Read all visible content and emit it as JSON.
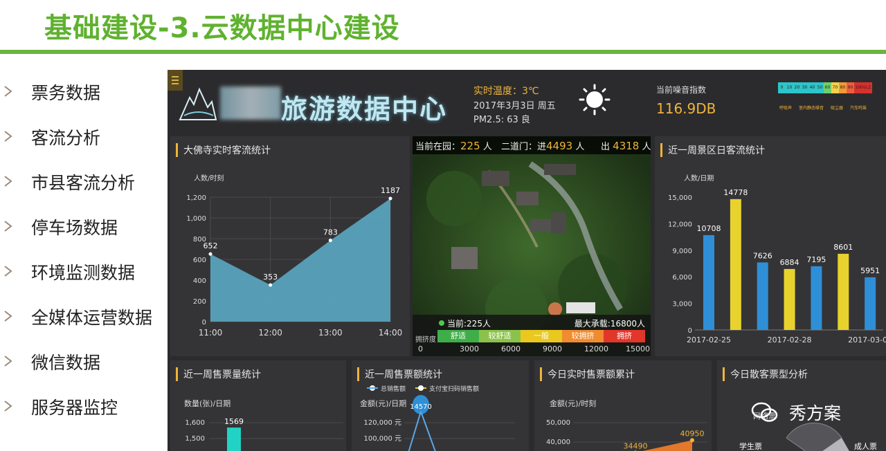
{
  "slide": {
    "title": "基础建设-3.云数据中心建设",
    "menu": [
      "票务数据",
      "客流分析",
      "市县客流分析",
      "停车场数据",
      "环境监测数据",
      "全媒体运营数据",
      "微信数据",
      "服务器监控"
    ]
  },
  "dashboard": {
    "title": "旅游数据中心",
    "temperature": "实时温度：3℃",
    "date": "2017年3月3日 周五",
    "pm25": "PM2.5: 63 良",
    "noise_label": "当前噪音指数",
    "noise_value": "116.9DB",
    "noise_scale": [
      "0",
      "10",
      "20",
      "30",
      "40",
      "50",
      "60",
      "70",
      "80",
      "90",
      "100以上"
    ],
    "noise_scale_colors": [
      "#2ec4c9",
      "#2ec4c9",
      "#2ec4c9",
      "#2ec4c9",
      "#2ec4c9",
      "#2ec4c9",
      "#6fcf6a",
      "#f2d34b",
      "#f29a38",
      "#ef5d3c",
      "#d9302c"
    ],
    "noise_tags": [
      "呼吸声",
      "室内静态噪音",
      "吸尘器",
      "汽车鸣笛"
    ]
  },
  "map": {
    "in_park_label": "当前在园：",
    "in_park_value": "225",
    "unit": "人",
    "gate_label": "二道门：进",
    "gate_value": "4493",
    "exit_label": "出",
    "exit_value": "4318",
    "current": "当前:225人",
    "max": "最大承载:16800人",
    "congestion_label": "拥挤度",
    "levels": [
      "舒适",
      "较舒适",
      "一般",
      "较拥挤",
      "拥挤"
    ],
    "level_colors": [
      "#3fae49",
      "#8bc34a",
      "#e9c81f",
      "#f08b2f",
      "#e2362b"
    ],
    "ticks": [
      "0",
      "3000",
      "6000",
      "9000",
      "12000",
      "15000"
    ]
  },
  "panels": {
    "realtime": "大佛寺实时客流统计",
    "week": "近一周景区日客流统计",
    "ticket_count": "近一周售票量统计",
    "ticket_amount": "近一周售票额统计",
    "today_sales": "今日实时售票额累计",
    "ticket_type": "今日散客票型分析"
  },
  "chart_data": [
    {
      "type": "area",
      "title": "大佛寺实时客流统计",
      "ylabel": "人数/时刻",
      "x": [
        "11:00",
        "12:00",
        "13:00",
        "14:00"
      ],
      "values": [
        652,
        353,
        783,
        1187
      ],
      "yticks": [
        "0",
        "200",
        "400",
        "600",
        "800",
        "1,000",
        "1,200"
      ],
      "ylim": [
        0,
        1200
      ]
    },
    {
      "type": "bar",
      "title": "近一周景区日客流统计",
      "ylabel": "人数/日期",
      "values": [
        10708,
        14778,
        7626,
        6884,
        7195,
        8601,
        5951
      ],
      "colors": [
        "#2e8fd6",
        "#e8d22e",
        "#2e8fd6",
        "#e8d22e",
        "#2e8fd6",
        "#e8d22e",
        "#2e8fd6"
      ],
      "xticks": [
        "2017-02-25",
        "2017-02-28",
        "2017-03-03"
      ],
      "yticks": [
        "0",
        "3,000",
        "6,000",
        "9,000",
        "12,000",
        "15,000"
      ],
      "ylim": [
        0,
        15000
      ]
    },
    {
      "type": "bar",
      "title": "近一周售票量统计",
      "ylabel": "数量(张)/日期",
      "values": [
        1569
      ],
      "yticks": [
        "1,500",
        "1,600"
      ]
    },
    {
      "type": "line",
      "title": "近一周售票额统计",
      "ylabel": "金额(元)/日期",
      "series": [
        {
          "name": "总销售额",
          "values": [
            14570
          ]
        },
        {
          "name": "支付宝扫码销售额",
          "values": []
        }
      ],
      "yticks": [
        "100,000 元",
        "120,000 元"
      ]
    },
    {
      "type": "area",
      "title": "今日实时售票额累计",
      "ylabel": "金额(元)/时刻",
      "values": [
        34490,
        40950
      ],
      "yticks": [
        "40,000",
        "50,000"
      ]
    },
    {
      "type": "pie",
      "title": "今日散客票型分析",
      "categories": [
        "学生票",
        "成人票",
        "网络票"
      ]
    }
  ],
  "watermark": "秀方案"
}
